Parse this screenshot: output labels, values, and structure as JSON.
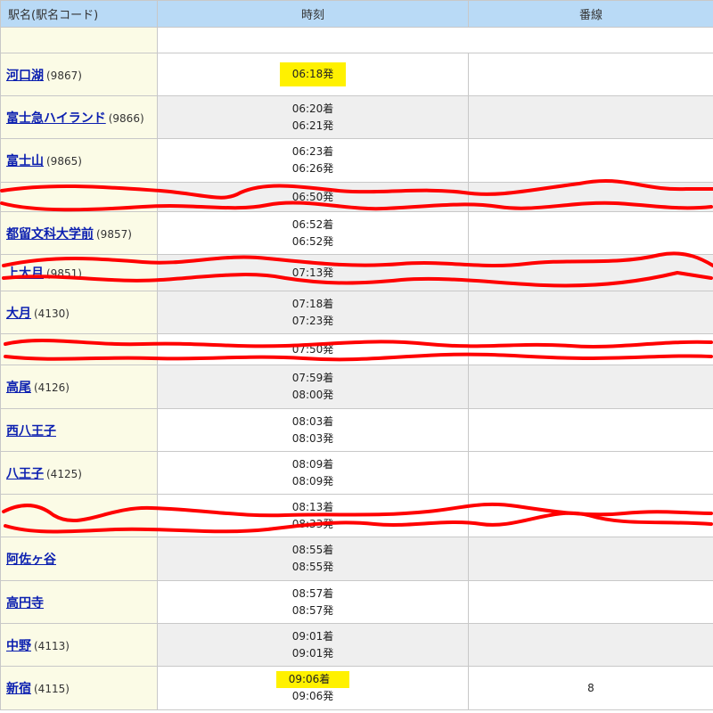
{
  "header": {
    "station": "駅名(駅名コード)",
    "time": "時刻",
    "track": "番線"
  },
  "rows": [
    {
      "name": "河口湖",
      "code": "(9867)",
      "times": [
        "06:18発"
      ],
      "track": "",
      "highlight": 0
    },
    {
      "name": "富士急ハイランド",
      "code": "(9866)",
      "times": [
        "06:20着",
        "06:21発"
      ],
      "track": ""
    },
    {
      "name": "富士山",
      "code": "(9865)",
      "times": [
        "06:23着",
        "06:26発"
      ],
      "track": ""
    },
    {
      "name": "",
      "code": "",
      "times": [
        "06:50発"
      ],
      "track": ""
    },
    {
      "name": "都留文科大学前",
      "code": "(9857)",
      "times": [
        "06:52着",
        "06:52発"
      ],
      "track": ""
    },
    {
      "name": "上大月",
      "code": "(9851)",
      "times": [
        "",
        "07:13発"
      ],
      "track": ""
    },
    {
      "name": "大月",
      "code": "(4130)",
      "times": [
        "07:18着",
        "07:23発"
      ],
      "track": ""
    },
    {
      "name": "",
      "code": "",
      "times": [
        "",
        "07:50発"
      ],
      "track": ""
    },
    {
      "name": "高尾",
      "code": "(4126)",
      "times": [
        "07:59着",
        "08:00発"
      ],
      "track": ""
    },
    {
      "name": "西八王子",
      "code": "",
      "times": [
        "08:03着",
        "08:03発"
      ],
      "track": ""
    },
    {
      "name": "八王子",
      "code": "(4125)",
      "times": [
        "08:09着",
        "08:09発"
      ],
      "track": ""
    },
    {
      "name": "",
      "code": "",
      "times": [
        "08:13着",
        "08:33発"
      ],
      "track": ""
    },
    {
      "name": "阿佐ヶ谷",
      "code": "",
      "times": [
        "08:55着",
        "08:55発"
      ],
      "track": ""
    },
    {
      "name": "高円寺",
      "code": "",
      "times": [
        "08:57着",
        "08:57発"
      ],
      "track": ""
    },
    {
      "name": "中野",
      "code": "(4113)",
      "times": [
        "09:01着",
        "09:01発"
      ],
      "track": ""
    },
    {
      "name": "新宿",
      "code": "(4115)",
      "times": [
        "09:06着",
        "09:06発"
      ],
      "track": "8",
      "highlight": 0
    }
  ],
  "colors": {
    "header_bg": "#b9daf6",
    "name_bg": "#fbfbe6",
    "row_alt": "#efefef",
    "link": "#0b1fb0",
    "highlight": "#fff100",
    "scribble": "#ff0000"
  }
}
